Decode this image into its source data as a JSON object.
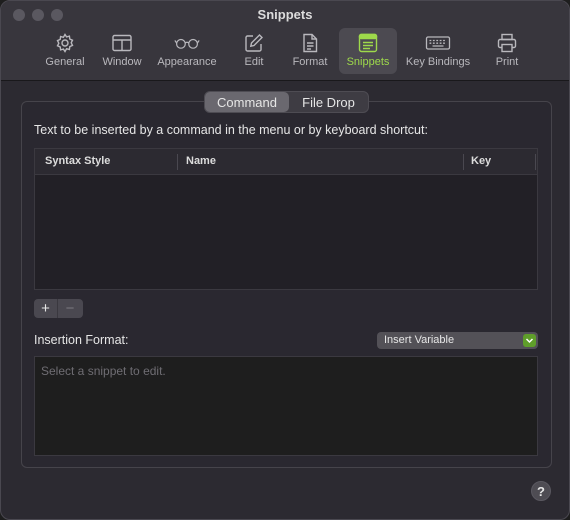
{
  "window": {
    "title": "Snippets"
  },
  "toolbar": {
    "items": [
      {
        "label": "General",
        "icon": "gear-icon"
      },
      {
        "label": "Window",
        "icon": "window-icon"
      },
      {
        "label": "Appearance",
        "icon": "glasses-icon"
      },
      {
        "label": "Edit",
        "icon": "pencil-square-icon"
      },
      {
        "label": "Format",
        "icon": "document-icon"
      },
      {
        "label": "Snippets",
        "icon": "snippets-icon",
        "active": true
      },
      {
        "label": "Key Bindings",
        "icon": "keyboard-icon"
      },
      {
        "label": "Print",
        "icon": "printer-icon"
      }
    ]
  },
  "tabs": {
    "command": "Command",
    "file_drop": "File Drop",
    "selected": "Command"
  },
  "main": {
    "description": "Text to be inserted by a command in the menu or by keyboard shortcut:",
    "table": {
      "columns": [
        "Syntax Style",
        "Name",
        "Key"
      ],
      "rows": []
    },
    "add_label": "+",
    "remove_label": "−",
    "insertion_label": "Insertion Format:",
    "insert_variable": "Insert Variable",
    "editor_placeholder": "Select a snippet to edit.",
    "help_label": "?"
  },
  "colors": {
    "accent": "#9ed94b",
    "popup_arrow": "#5f9e2a"
  }
}
